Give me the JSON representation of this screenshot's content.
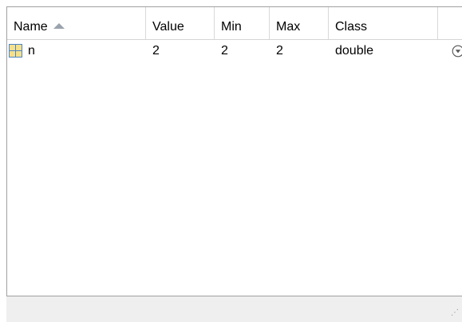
{
  "table": {
    "columns": [
      {
        "label": "Name",
        "sorted": "ascending"
      },
      {
        "label": "Value"
      },
      {
        "label": "Min"
      },
      {
        "label": "Max"
      },
      {
        "label": "Class"
      }
    ],
    "rows": [
      {
        "icon": "matrix-variable-icon",
        "name": "n",
        "value": "2",
        "min": "2",
        "max": "2",
        "class": "double",
        "action_icon": "dropdown-circle-icon"
      }
    ]
  },
  "status_bar": {
    "grip_icon": "resize-grip-icon"
  },
  "colors": {
    "header_border": "#d9d9d9",
    "sort_arrow": "#9aa3ad",
    "status_bar": "#efefef",
    "matrix_icon_fill": "#f7e08a",
    "matrix_icon_stroke": "#4a86c8"
  }
}
